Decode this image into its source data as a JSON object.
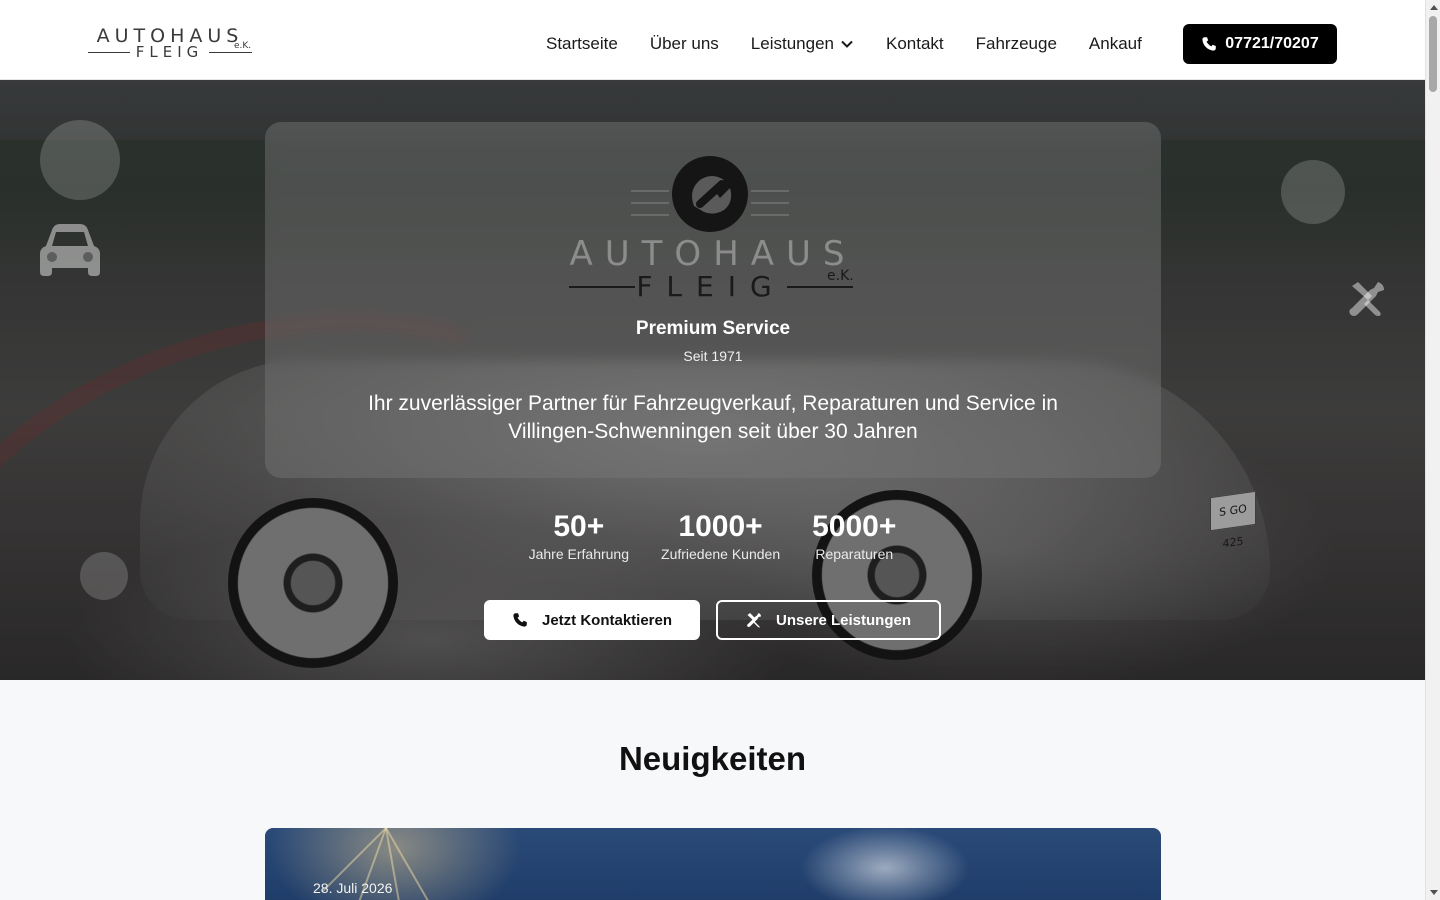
{
  "header": {
    "logo": {
      "top": "AUTOHAUS",
      "bottom": "FLEIG",
      "suffix": "e.K."
    },
    "nav": [
      {
        "label": "Startseite"
      },
      {
        "label": "Über uns"
      },
      {
        "label": "Leistungen",
        "dropdown": true
      },
      {
        "label": "Kontakt"
      },
      {
        "label": "Fahrzeuge"
      },
      {
        "label": "Ankauf"
      }
    ],
    "phone_label": "07721/70207",
    "phone_icon": "phone-icon"
  },
  "hero": {
    "logo": {
      "top": "AUTOHAUS",
      "bottom": "FLEIG",
      "suffix": "e.K."
    },
    "premium": "Premium Service",
    "since": "Seit 1971",
    "tagline": "Ihr zuverlässiger Partner für Fahrzeugverkauf, Reparaturen und Service in Villingen-Schwenningen seit über 30 Jahren",
    "plate": "S GO 425",
    "stats": [
      {
        "value": "50+",
        "label": "Jahre Erfahrung"
      },
      {
        "value": "1000+",
        "label": "Zufriedene Kunden"
      },
      {
        "value": "5000+",
        "label": "Reparaturen"
      }
    ],
    "cta_primary": {
      "label": "Jetzt Kontaktieren",
      "icon": "phone-icon"
    },
    "cta_secondary": {
      "label": "Unsere Leistungen",
      "icon": "tools-icon"
    },
    "deco_icons": [
      "car-icon",
      "tools-icon"
    ]
  },
  "news": {
    "title": "Neuigkeiten",
    "items": [
      {
        "date": "28. Juli 2026"
      }
    ]
  },
  "colors": {
    "header_bg": "#ffffff",
    "phone_button_bg": "#000000",
    "page_bg": "#f7f8fa"
  }
}
